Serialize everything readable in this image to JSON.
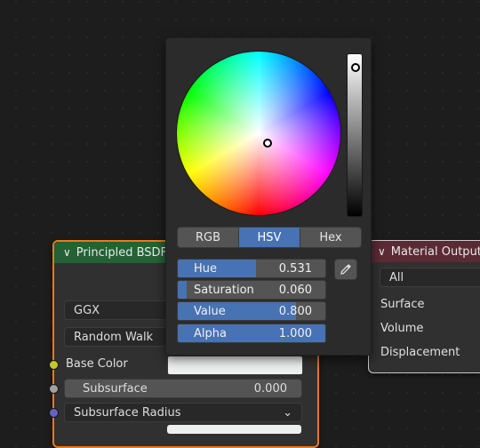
{
  "principled_node": {
    "title": "Principled BSDF",
    "distribution": "GGX",
    "subsurface_method": "Random Walk",
    "sockets": [
      {
        "label": "Base Color",
        "color": "#c7c729"
      },
      {
        "label": "Subsurface",
        "value": "0.000",
        "color": "#a1a1a1"
      },
      {
        "label": "Subsurface Radius",
        "color": "#6363c7"
      }
    ],
    "header_color": "#246136",
    "selected_outline_color": "#e8791e"
  },
  "material_output_node": {
    "title": "Material Output",
    "target": "All",
    "sockets": [
      "Surface",
      "Volume",
      "Displacement"
    ],
    "header_color": "#5a2a35"
  },
  "color_picker": {
    "tabs": [
      "RGB",
      "HSV",
      "Hex"
    ],
    "active_tab": "HSV",
    "sliders": [
      {
        "label": "Hue",
        "value": "0.531",
        "fraction": 0.531
      },
      {
        "label": "Saturation",
        "value": "0.060",
        "fraction": 0.06
      },
      {
        "label": "Value",
        "value": "0.800",
        "fraction": 0.8
      },
      {
        "label": "Alpha",
        "value": "1.000",
        "fraction": 1.0
      }
    ],
    "eyedropper_icon": "eyedropper-icon",
    "accent_color": "#4772b3"
  }
}
